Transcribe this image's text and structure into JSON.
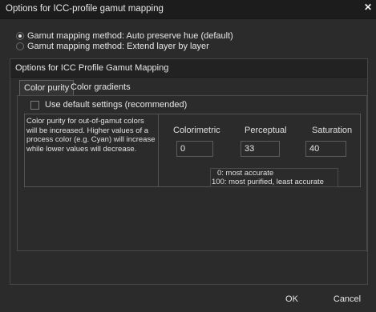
{
  "window": {
    "title": "Options for ICC-profile gamut mapping",
    "close_icon": "close-icon"
  },
  "mapping_methods": [
    {
      "label": "Gamut mapping method: Auto preserve hue (default)",
      "selected": true
    },
    {
      "label": "Gamut mapping method: Extend layer by layer",
      "selected": false
    }
  ],
  "group": {
    "title": "Options for ICC Profile Gamut Mapping",
    "tabs": [
      {
        "label": "Color purity",
        "active": true
      },
      {
        "label": "Color gradients",
        "active": false
      }
    ],
    "default_settings": {
      "label": "Use default settings (recommended)",
      "checked": false
    },
    "description": "Color purity for out-of-gamut colors will be increased. Higher values of a process color (e.g. Cyan) will increase while lower values will decrease.",
    "columns": [
      {
        "label": "Colorimetric",
        "value": "0"
      },
      {
        "label": "Perceptual",
        "value": "33"
      },
      {
        "label": "Saturation",
        "value": "40"
      }
    ],
    "legend": {
      "line1": "0: most accurate",
      "line2": "100: most purified, least accurate"
    }
  },
  "buttons": {
    "ok": "OK",
    "cancel": "Cancel"
  }
}
